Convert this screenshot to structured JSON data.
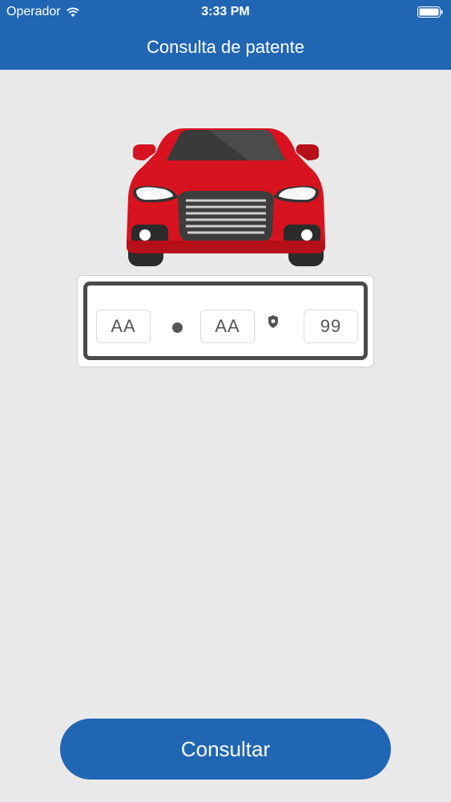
{
  "status_bar": {
    "carrier": "Operador",
    "time": "3:33 PM"
  },
  "nav": {
    "title": "Consulta de patente"
  },
  "plate": {
    "field1_value": "AA",
    "field2_value": "AA",
    "field3_value": "99"
  },
  "actions": {
    "consultar_label": "Consultar"
  },
  "colors": {
    "primary": "#2166b3",
    "background": "#e9e9ea",
    "car_red": "#d7131f"
  },
  "icons": [
    "wifi-icon",
    "battery-icon",
    "car-illustration",
    "shield-icon"
  ]
}
